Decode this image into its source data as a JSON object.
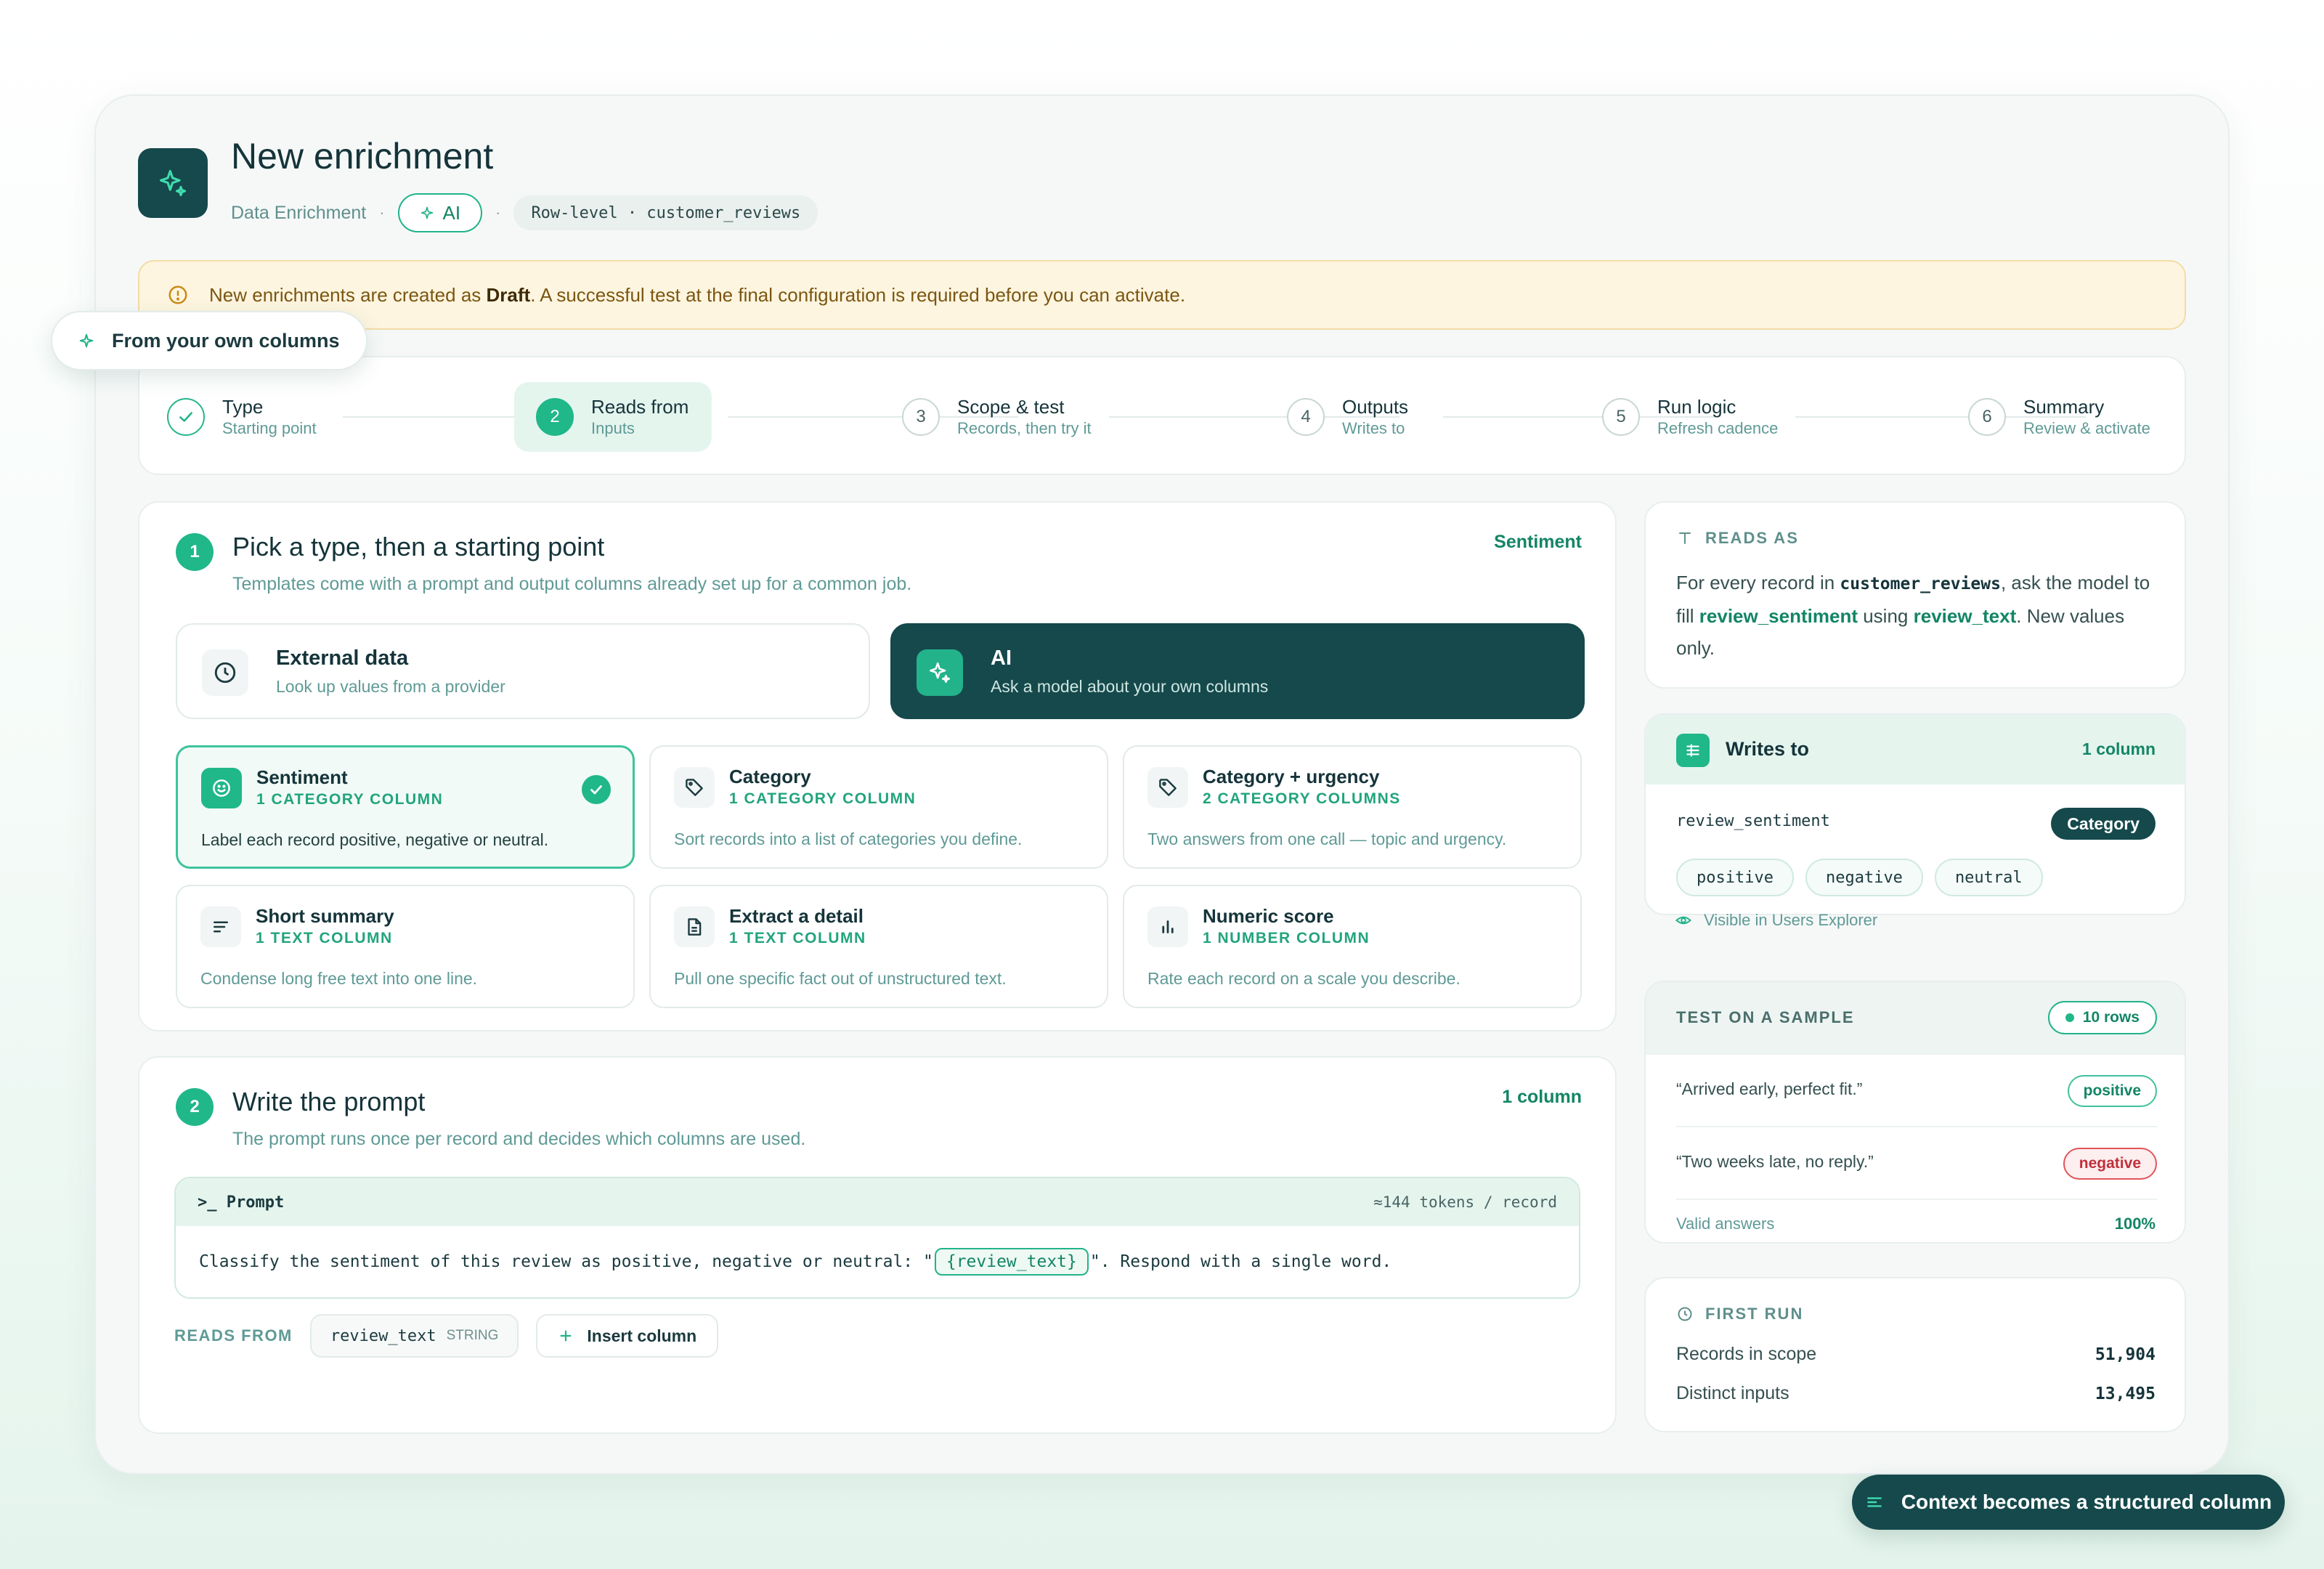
{
  "header": {
    "title": "New enrichment",
    "subtitle": "Data Enrichment",
    "ai_label": "AI",
    "scope_label": "Row-level · customer_reviews"
  },
  "alert": {
    "pre": "New enrichments are created as ",
    "bold": "Draft",
    "post": ". A successful test at the final configuration is required before you can activate."
  },
  "floating_tag": "From your own columns",
  "stepper": [
    {
      "num": "",
      "title": "Type",
      "sub": "Starting point",
      "state": "done"
    },
    {
      "num": "2",
      "title": "Reads from",
      "sub": "Inputs",
      "state": "active"
    },
    {
      "num": "3",
      "title": "Scope & test",
      "sub": "Records, then try it",
      "state": "todo"
    },
    {
      "num": "4",
      "title": "Outputs",
      "sub": "Writes to",
      "state": "todo"
    },
    {
      "num": "5",
      "title": "Run logic",
      "sub": "Refresh cadence",
      "state": "todo"
    },
    {
      "num": "6",
      "title": "Summary",
      "sub": "Review & activate",
      "state": "todo"
    }
  ],
  "section1": {
    "num": "1",
    "title": "Pick a type, then a starting point",
    "sub": "Templates come with a prompt and output columns already set up for a common job.",
    "right": "Sentiment",
    "types": [
      {
        "title": "External data",
        "sub": "Look up values from a provider",
        "icon": "clock-icon",
        "selected": false
      },
      {
        "title": "AI",
        "sub": "Ask a model about your own columns",
        "icon": "sparkle-icon",
        "selected": true
      }
    ],
    "templates": [
      {
        "title": "Sentiment",
        "cols": "1 CATEGORY COLUMN",
        "desc": "Label each record positive, negative or neutral.",
        "icon": "smile-icon",
        "selected": true
      },
      {
        "title": "Category",
        "cols": "1 CATEGORY COLUMN",
        "desc": "Sort records into a list of categories you define.",
        "icon": "tag-icon",
        "selected": false
      },
      {
        "title": "Category + urgency",
        "cols": "2 CATEGORY COLUMNS",
        "desc": "Two answers from one call — topic and urgency.",
        "icon": "tag-icon",
        "selected": false
      },
      {
        "title": "Short summary",
        "cols": "1 TEXT COLUMN",
        "desc": "Condense long free text into one line.",
        "icon": "lines-icon",
        "selected": false
      },
      {
        "title": "Extract a detail",
        "cols": "1 TEXT COLUMN",
        "desc": "Pull one specific fact out of unstructured text.",
        "icon": "document-icon",
        "selected": false
      },
      {
        "title": "Numeric score",
        "cols": "1 NUMBER COLUMN",
        "desc": "Rate each record on a scale you describe.",
        "icon": "bar-chart-icon",
        "selected": false
      }
    ]
  },
  "section2": {
    "num": "2",
    "title": "Write the prompt",
    "sub": "The prompt runs once per record and decides which columns are used.",
    "right": "1 column",
    "prompt_label": ">_ Prompt",
    "tokens": "≈144 tokens / record",
    "prompt_pre": "Classify the sentiment of this review as positive, negative or neutral: \"",
    "prompt_token": "{review_text}",
    "prompt_post": "\". Respond with a single word.",
    "reads_from_label": "READS FROM",
    "chip_name": "review_text",
    "chip_type": "STRING",
    "insert_label": "Insert column"
  },
  "reads_as": {
    "eyebrow": "READS AS",
    "t1": "For every record in ",
    "table": "customer_reviews",
    "t2": ", ask the model to fill ",
    "target": "review_sentiment",
    "t3": " using ",
    "source": "review_text",
    "t4": ". New values only."
  },
  "writes_to": {
    "title": "Writes to",
    "count": "1 column",
    "column": "review_sentiment",
    "type": "Category",
    "options": [
      "positive",
      "negative",
      "neutral"
    ],
    "visibility": "Visible in Users Explorer"
  },
  "sample": {
    "eyebrow": "TEST ON A SAMPLE",
    "rows": "10 rows",
    "results": [
      {
        "text": "“Arrived early, perfect fit.”",
        "label": "positive",
        "kind": "pos"
      },
      {
        "text": "“Two weeks late, no reply.”",
        "label": "negative",
        "kind": "neg"
      }
    ],
    "valid_label": "Valid answers",
    "valid_value": "100%"
  },
  "first_run": {
    "eyebrow": "FIRST RUN",
    "records_label": "Records in scope",
    "records_value": "51,904",
    "distinct_label": "Distinct inputs",
    "distinct_value": "13,495"
  },
  "cta": "Context becomes a structured column",
  "colors": {
    "accent": "#20b789",
    "dark": "#15494c",
    "warn_bg": "#fdf5df",
    "negative": "#e1555a"
  }
}
